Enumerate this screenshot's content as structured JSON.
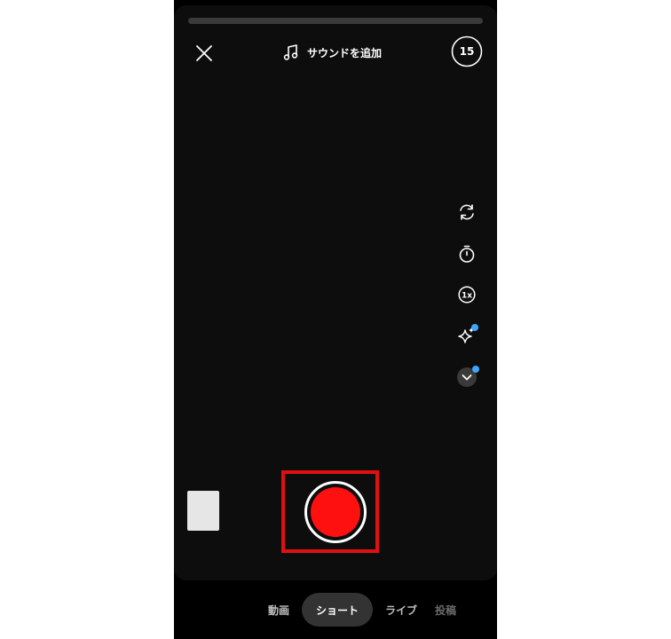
{
  "topbar": {
    "sound_label": "サウンドを追加",
    "duration": "15",
    "recording_progress": 0
  },
  "icons": {
    "close": "close-icon",
    "sound": "music-note-icon",
    "flip": "flip-camera-icon",
    "timer": "timer-icon",
    "speed": "speed-1x-icon",
    "effects": "sparkle-icon",
    "more": "chevron-down-icon"
  },
  "side_tools": {
    "speed_label": "1x"
  },
  "mode_tabs": [
    {
      "label": "動画"
    },
    {
      "label": "ショート"
    },
    {
      "label": "ライブ"
    },
    {
      "label": "投稿"
    }
  ],
  "active_mode": "ショート",
  "colors": {
    "record": "#ff1010",
    "highlight": "#e01010",
    "badge": "#3ea6ff"
  }
}
